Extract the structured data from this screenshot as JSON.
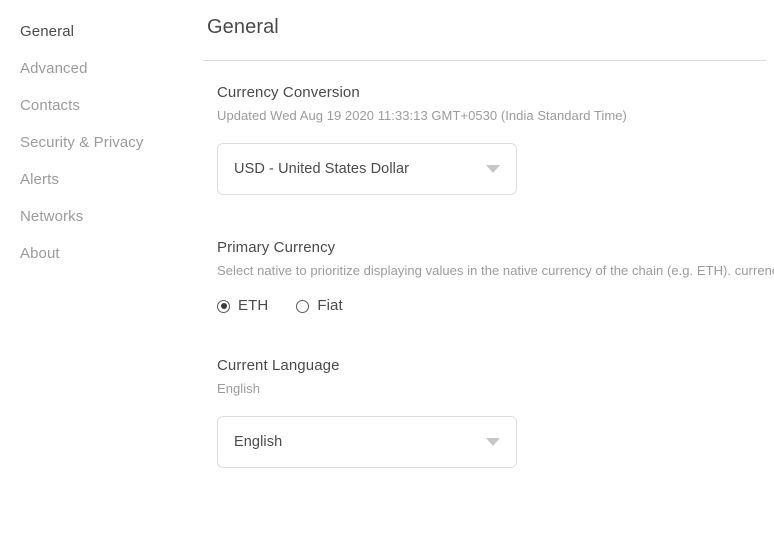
{
  "sidebar": {
    "items": [
      {
        "label": "General",
        "active": true
      },
      {
        "label": "Advanced",
        "active": false
      },
      {
        "label": "Contacts",
        "active": false
      },
      {
        "label": "Security & Privacy",
        "active": false
      },
      {
        "label": "Alerts",
        "active": false
      },
      {
        "label": "Networks",
        "active": false
      },
      {
        "label": "About",
        "active": false
      }
    ]
  },
  "header": {
    "title": "General"
  },
  "sections": {
    "currency_conversion": {
      "heading": "Currency Conversion",
      "updated_text": "Updated Wed Aug 19 2020 11:33:13 GMT+0530 (India Standard Time)",
      "select": {
        "value": "USD - United States Dollar",
        "caret_icon": "chevron-down-icon"
      }
    },
    "primary_currency": {
      "heading": "Primary Currency",
      "description": "Select native to prioritize displaying values in the native currency of the chain (e.g. ETH). currency.",
      "options": [
        {
          "label": "ETH",
          "checked": true
        },
        {
          "label": "Fiat",
          "checked": false
        }
      ]
    },
    "current_language": {
      "heading": "Current Language",
      "subtext": "English",
      "select": {
        "value": "English",
        "caret_icon": "chevron-down-icon"
      }
    }
  },
  "colors": {
    "text_primary": "#4a4a4a",
    "text_muted": "#9b9b9b",
    "border": "#dedede",
    "divider": "#d8d8d8",
    "caret": "#c6c6c6",
    "radio": "#3b3b3b"
  }
}
